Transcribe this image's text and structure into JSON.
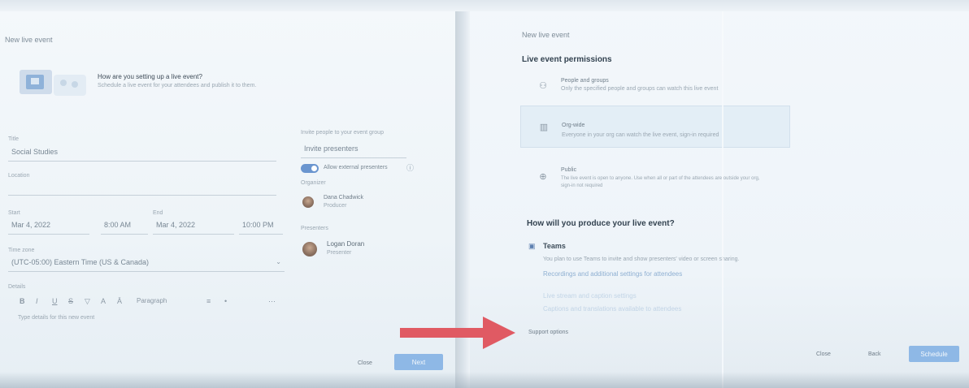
{
  "left": {
    "header": "New live event",
    "setup_title": "How are you setting up a live event?",
    "setup_desc": "Schedule a live event for your attendees and publish it to them.",
    "title_label": "Title",
    "title_value": "Social Studies",
    "location_label": "Location",
    "start_label": "Start",
    "start_date": "Mar 4, 2022",
    "start_time": "8:00 AM",
    "end_label": "End",
    "end_date": "Mar 4, 2022",
    "end_time": "10:00 PM",
    "timezone_label": "Time zone",
    "timezone_value": "(UTC-05:00) Eastern Time (US & Canada)",
    "details_label": "Details",
    "details_placeholder": "Type details for this new event",
    "invite_label": "Invite people to your event group",
    "invite_input": "Invite presenters",
    "toggle_label": "Allow external presenters",
    "organizer_label": "Organizer",
    "organizer_name": "Dana Chadwick",
    "organizer_role": "Producer",
    "presenter_label": "Presenters",
    "presenter_name": "Logan Doran",
    "presenter_role": "Presenter",
    "close": "Close",
    "next": "Next",
    "toolbar": [
      "B",
      "I",
      "U",
      "S",
      "▽",
      "A",
      "Ā",
      "Paragraph",
      "≡",
      "•",
      "⋯"
    ]
  },
  "right": {
    "header": "New live event",
    "permissions_title": "Live event permissions",
    "options": [
      {
        "icon": "people-icon",
        "title": "People and groups",
        "desc": "Only the specified people and groups can watch this live event"
      },
      {
        "icon": "building-icon",
        "title": "Org-wide",
        "desc": "Everyone in your org can watch the live event, sign-in required"
      },
      {
        "icon": "globe-icon",
        "title": "Public",
        "desc": "The live event is open to anyone. Use when all or part of the attendees are outside your org, sign-in not required"
      }
    ],
    "produce_title": "How will you produce your live event?",
    "teams_label": "Teams",
    "teams_desc": "You plan to use Teams to invite and show presenters' video or screen sharing.",
    "teams_link": "Recordings and additional settings for attendees",
    "faded_link_1": "Live stream and caption settings",
    "faded_link_2": "Captions and translations available to attendees",
    "support_label": "Support options",
    "back": "Back",
    "schedule": "Schedule",
    "cancel": "Close"
  }
}
